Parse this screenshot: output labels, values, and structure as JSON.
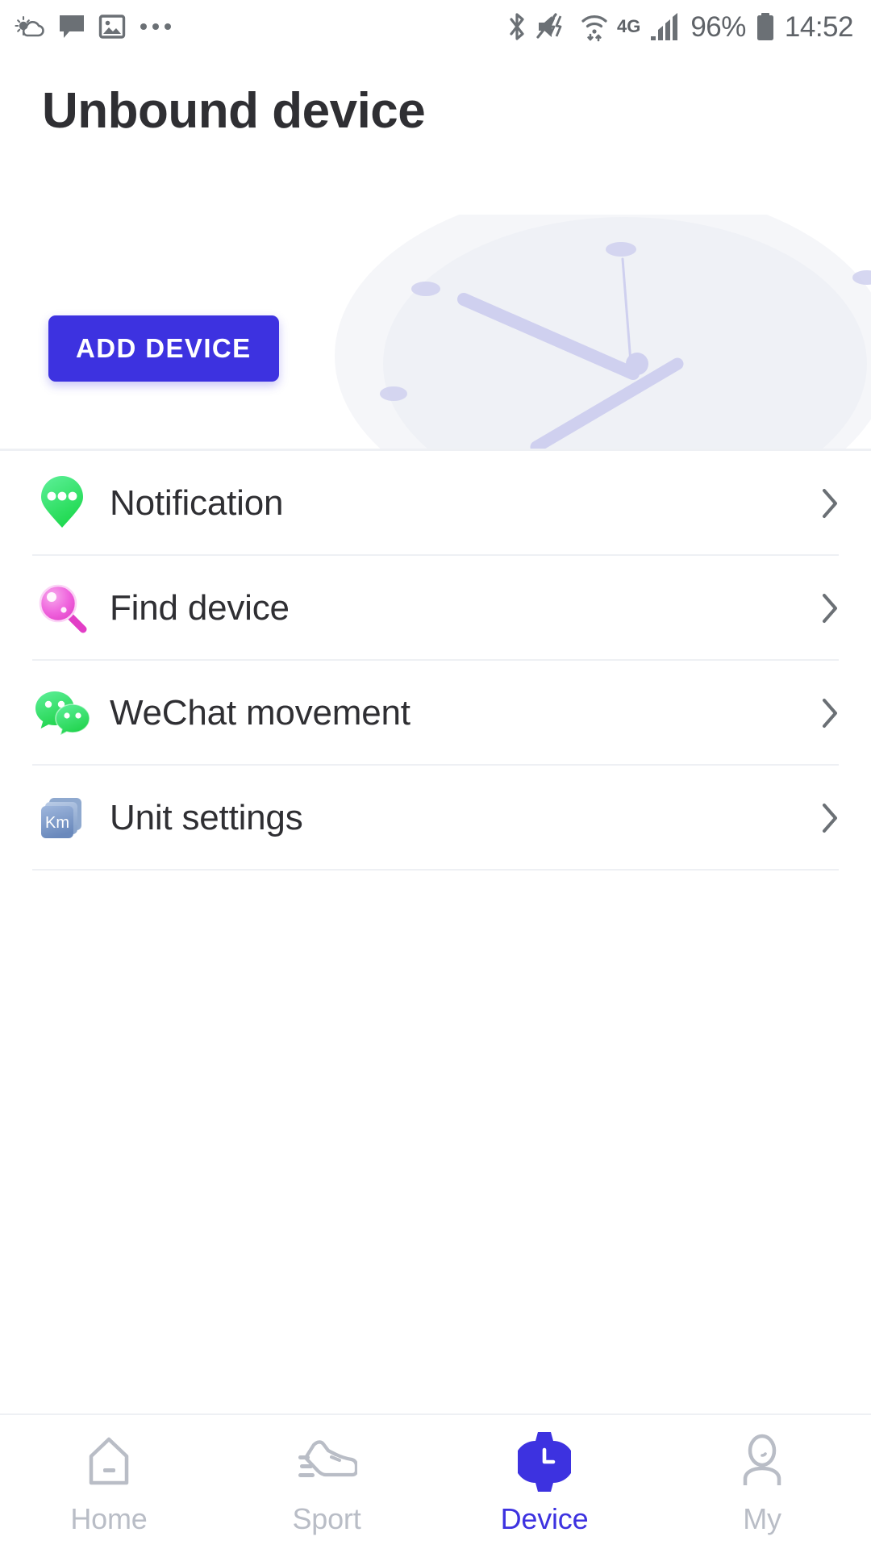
{
  "status_bar": {
    "left_icons": [
      "weather-cloud-sun-icon",
      "message-bubble-icon",
      "photo-image-icon",
      "more-dots-icon"
    ],
    "right_icons": [
      "bluetooth-icon",
      "mute-vibrate-icon",
      "wifi-icon",
      "signal-bars-icon",
      "battery-icon"
    ],
    "network_type": "4G",
    "battery_percent": "96%",
    "time": "14:52"
  },
  "header": {
    "title": "Unbound device",
    "add_device_label": "ADD DEVICE",
    "accent_color": "#3d32e0",
    "watch_illustration": "watch-face-illustration"
  },
  "menu": {
    "items": [
      {
        "label": "Notification",
        "icon": "notification-bubble-icon",
        "icon_color": "#3ddc6e",
        "chevron": "chevron-right-icon"
      },
      {
        "label": "Find device",
        "icon": "magnifier-find-icon",
        "icon_color": "#e855d6",
        "chevron": "chevron-right-icon"
      },
      {
        "label": "WeChat movement",
        "icon": "wechat-logo-icon",
        "icon_color": "#3ddc6e",
        "chevron": "chevron-right-icon"
      },
      {
        "label": "Unit settings",
        "icon": "unit-km-cards-icon",
        "icon_color": "#7f9cc9",
        "chevron": "chevron-right-icon",
        "icon_text": "Km"
      }
    ]
  },
  "tabbar": {
    "active_color": "#3d32e0",
    "inactive_color": "#b9bdc6",
    "tabs": [
      {
        "label": "Home",
        "icon": "home-icon",
        "active": false
      },
      {
        "label": "Sport",
        "icon": "running-shoe-icon",
        "active": false
      },
      {
        "label": "Device",
        "icon": "smartwatch-icon",
        "active": true
      },
      {
        "label": "My",
        "icon": "person-icon",
        "active": false
      }
    ]
  }
}
